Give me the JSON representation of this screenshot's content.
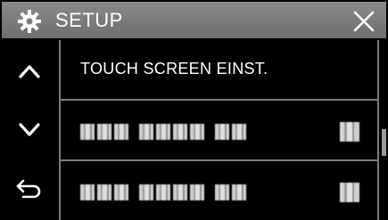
{
  "titlebar": {
    "title": "SETUP",
    "icon": "gear-icon",
    "close_icon": "close-icon"
  },
  "nav": {
    "up_icon": "chevron-up-icon",
    "down_icon": "chevron-down-icon",
    "back_icon": "return-arrow-icon"
  },
  "list": {
    "items": [
      {
        "label": "TOUCH SCREEN EINST."
      }
    ]
  },
  "colors": {
    "titlebar": "#7a7a7a",
    "background": "#000000",
    "text": "#ffffff",
    "divider": "#7a7a7a"
  }
}
